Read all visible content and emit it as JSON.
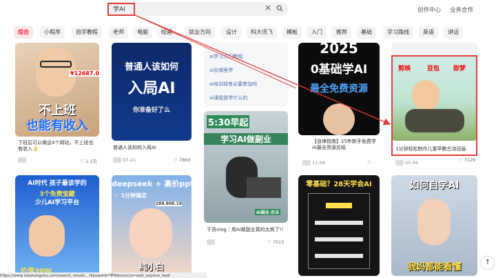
{
  "search": {
    "value": "学AI",
    "clear_icon": "close-icon",
    "icon": "search-icon"
  },
  "header": {
    "creator_center": "创作中心",
    "business": "业务合作"
  },
  "tabs": [
    "综合",
    "小程序",
    "自学教程",
    "老师",
    "电脑",
    "绘画",
    "就业方向",
    "设计",
    "科大讯飞",
    "模板",
    "入门",
    "推荐",
    "基础",
    "学习路线",
    "英语",
    "讲话"
  ],
  "cards": {
    "c1": {
      "overlay_price": "¥12687.00",
      "overlay_line1": "不上班",
      "overlay_line2": "也能有收入",
      "caption": "下班后可以做这4个网站，不上班也有收入👌",
      "likes": "1.1万"
    },
    "c2": {
      "overlay_line1": "普通人该如何",
      "overlay_line2": "入局AI",
      "overlay_line3": "你准备好了么",
      "caption": "普通人该如何入局AI",
      "author": "07-21",
      "likes": "7860"
    },
    "c3": {
      "links": [
        "ai学习入门教程",
        "ai去哪里学",
        "ai培训班有必要参加吗",
        "ai课程是学什么的"
      ]
    },
    "c4": {
      "overlay_time": "5:30早起",
      "overlay_title": "学习AI做副业",
      "overlay_badge": "AI副业·办法",
      "caption": "干货vlog｜用AI做副业真的太爽了!!",
      "likes": "7015"
    },
    "c5": {
      "overlay_year": "2025",
      "overlay_line1": "0基础学AI",
      "overlay_line2": "最全免费资源",
      "caption": "【自律指南】25年新手免费学AI最全资源总结",
      "author": "11-08"
    },
    "c6": {
      "overlay_tags": [
        "剪映",
        "豆包",
        "即梦"
      ],
      "caption": "1分钟轻松制作儿童早教古诗动画",
      "author": "05-06",
      "likes": "7126"
    },
    "c7": {
      "overlay_line1": "AI时代 孩子最该学的",
      "overlay_line2": "3个免费宝藏",
      "overlay_line3": "少儿AI学习平台",
      "overlay_bottom": "价值30W"
    },
    "c8": {
      "overlay_line1": "deepseek + 高价ppt",
      "overlay_line2": "✓ 1分钟搞定",
      "overlay_price": "288.808.19",
      "overlay_bottom": "纯小白"
    },
    "c9": {
      "overlay_line1": "零基础？28天学会AI"
    },
    "c10": {
      "overlay_line1": "如何自学AI",
      "overlay_bottom": "我妈都能看懂"
    }
  },
  "status_url": "https://www.xiaohongshu.com/search_result/...?keyword=学AI&source=web_explore_feed",
  "colors": {
    "accent": "#ff2442",
    "highlight": "#e23b3b"
  }
}
